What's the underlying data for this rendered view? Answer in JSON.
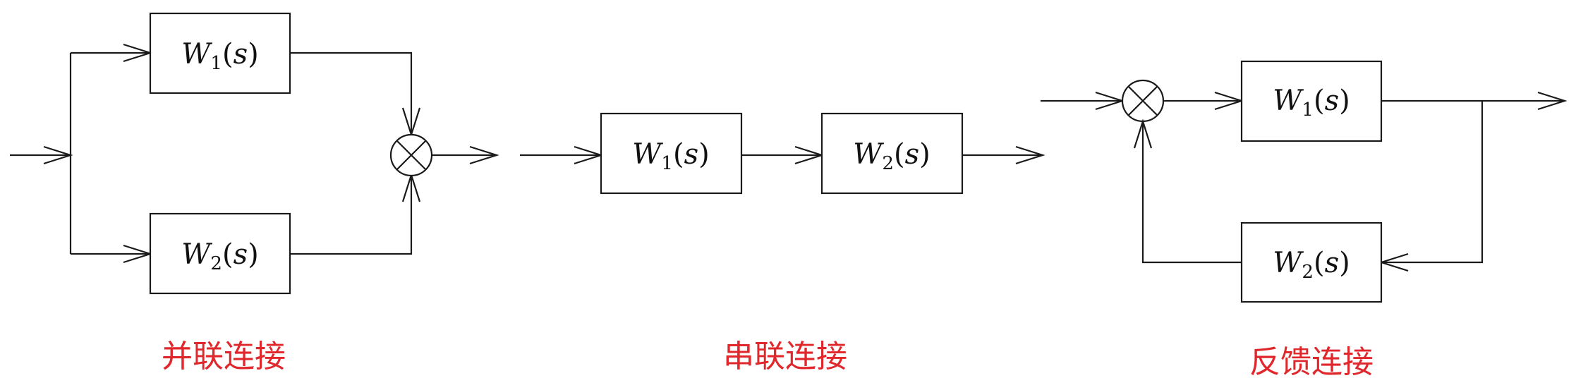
{
  "colors": {
    "line": "#1a1a1a",
    "caption": "#e0272b"
  },
  "blocks": {
    "w1": {
      "symbol": "W",
      "sub": "1",
      "arg": "s"
    },
    "w2": {
      "symbol": "W",
      "sub": "2",
      "arg": "s"
    }
  },
  "captions": {
    "parallel": "并联连接",
    "series": "串联连接",
    "feedback": "反馈连接"
  }
}
